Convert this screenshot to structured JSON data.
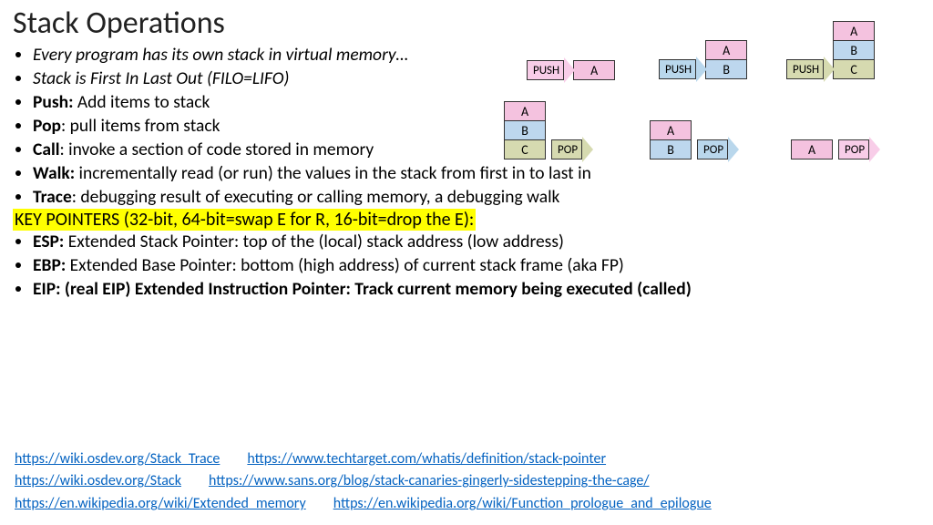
{
  "title": "Stack Operations",
  "bullets": {
    "b1": "Every program has its own stack in virtual memory…",
    "b2": "Stack is First In Last Out (FILO=LIFO)",
    "b3h": "Push:",
    "b3": " Add items to stack",
    "b4h": "Pop",
    "b4": ": pull items from stack",
    "b5h": "Call",
    "b5": ": invoke a section of code stored in memory",
    "b6h": "Walk:",
    "b6": " incrementally read (or run) the values in the stack from first in to last in",
    "b7h": "Trace",
    "b7": ": debugging result of executing or calling memory, a debugging walk"
  },
  "key_line": "KEY POINTERS (32-bit, 64-bit=swap E for R, 16-bit=drop the E):",
  "pointers": {
    "p1h": "ESP:",
    "p1b": " Extended Stack Pointer: ",
    "p1": "top of the (local) stack address (low address)",
    "p2h": "EBP:",
    "p2b": " Extended Base Pointer: ",
    "p2": "bottom (high address) of current stack frame (aka FP)",
    "p3h": "EIP: (real EIP) ",
    "p3": "Extended Instruction Pointer: Track current memory being executed (called)"
  },
  "links": {
    "l1": "https://wiki.osdev.org/Stack_Trace",
    "l2": "https://www.techtarget.com/whatis/definition/stack-pointer",
    "l3": "https://wiki.osdev.org/Stack",
    "l4": "https://www.sans.org/blog/stack-canaries-gingerly-sidestepping-the-cage/",
    "l5": "https://en.wikipedia.org/wiki/Extended_memory",
    "l6": "https://en.wikipedia.org/wiki/Function_prologue_and_epilogue"
  },
  "labels": {
    "push": "PUSH",
    "pop": "POP",
    "A": "A",
    "B": "B",
    "C": "C"
  }
}
